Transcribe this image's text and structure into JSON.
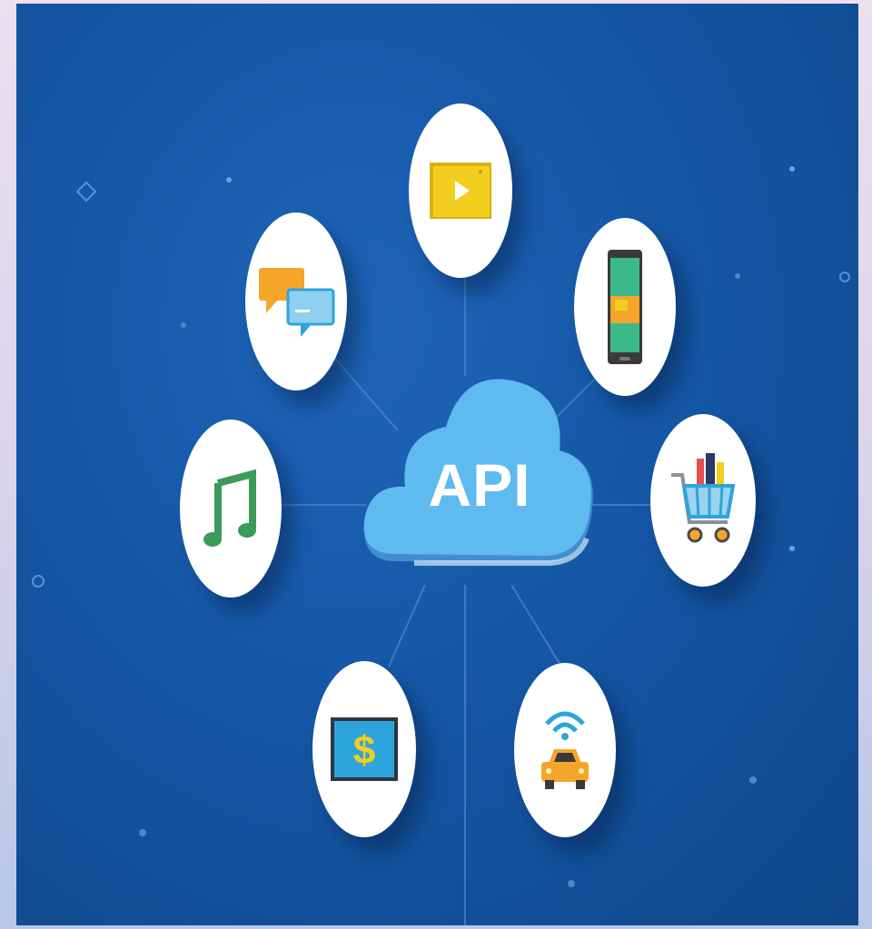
{
  "center": {
    "label": "API",
    "icon": "cloud-icon"
  },
  "nodes": [
    {
      "id": "video",
      "icon": "video-player-icon"
    },
    {
      "id": "mobile",
      "icon": "mobile-phone-icon"
    },
    {
      "id": "shopping",
      "icon": "shopping-cart-icon"
    },
    {
      "id": "iot-car",
      "icon": "connected-car-icon"
    },
    {
      "id": "payment",
      "icon": "dollar-screen-icon"
    },
    {
      "id": "music",
      "icon": "music-note-icon"
    },
    {
      "id": "messaging",
      "icon": "chat-bubbles-icon"
    }
  ],
  "colors": {
    "background": "#1557a6",
    "cloud": "#5fbaf0",
    "accent_yellow": "#f2cf1e",
    "accent_orange": "#f4a52a",
    "accent_green": "#3d9a5a",
    "accent_blue": "#2ea4dc"
  }
}
